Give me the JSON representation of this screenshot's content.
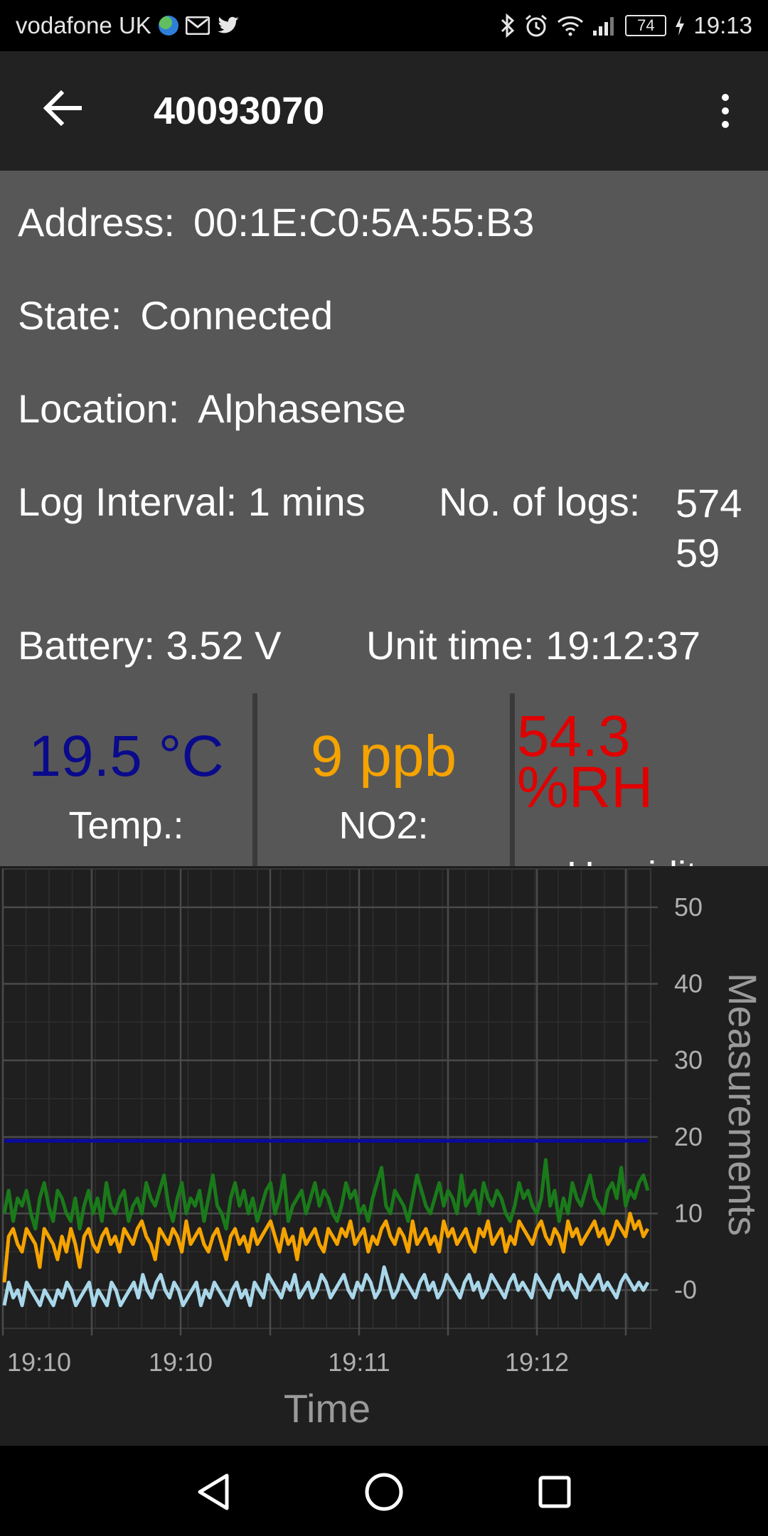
{
  "status_bar": {
    "carrier": "vodafone UK",
    "battery": "74",
    "time": "19:13",
    "left_icons": [
      "globe-icon",
      "gmail-icon",
      "twitter-icon"
    ],
    "right_icons": [
      "bluetooth-icon",
      "alarm-icon",
      "wifi-icon",
      "signal-icon",
      "battery-icon",
      "charging-icon"
    ]
  },
  "app_bar": {
    "title": "40093070",
    "back_icon": "arrow-left-icon",
    "menu_icon": "more-vert-icon"
  },
  "device_info": {
    "address_label": "Address:",
    "address_value": "00:1E:C0:5A:55:B3",
    "state_label": "State:",
    "state_value": "Connected",
    "location_label": "Location:",
    "location_value": "Alphasense",
    "log_interval_label": "Log Interval:",
    "log_interval_value": "1 mins",
    "logs_label": "No. of logs:",
    "logs_value_line1": "574",
    "logs_value_line2": "59",
    "battery_label": "Battery:",
    "battery_value": "3.52 V",
    "unit_time_label": "Unit time:",
    "unit_time_value": "19:12:37"
  },
  "tiles": [
    {
      "value": "19.5 °C",
      "label": "Temp.:",
      "color": "#0a0a8c"
    },
    {
      "value": "9 ppb",
      "label": "NO2:",
      "color": "#f5a300"
    },
    {
      "value_line1": "54.3",
      "value_line2": "%RH",
      "label_partial": "Humidity",
      "color": "#e00000"
    }
  ],
  "chart_data": {
    "type": "line",
    "xlabel": "Time",
    "ylabel": "Measurements",
    "x_ticks": [
      "19:10",
      "19:10",
      "19:11",
      "19:12"
    ],
    "y_ticks": [
      "50",
      "40",
      "30",
      "20",
      "10",
      "-0"
    ],
    "ylim": [
      -5,
      55
    ],
    "grid": true,
    "background": "#1f1f1f",
    "series": [
      {
        "color": "#0a0aa0",
        "values": [
          19.5,
          19.5,
          19.5,
          19.5,
          19.5,
          19.5,
          19.5,
          19.5,
          19.5,
          19.5,
          19.5,
          19.5,
          19.5,
          19.5,
          19.5,
          19.5,
          19.5,
          19.5,
          19.5,
          19.5,
          19.5,
          19.5,
          19.5,
          19.5,
          19.5,
          19.5,
          19.5,
          19.5,
          19.5,
          19.5,
          19.5,
          19.5,
          19.5,
          19.5,
          19.5,
          19.5,
          19.5,
          19.5,
          19.5,
          19.5,
          19.5,
          19.5,
          19.5,
          19.5,
          19.5,
          19.5,
          19.5,
          19.5,
          19.5,
          19.5,
          19.5,
          19.5,
          19.5,
          19.5,
          19.5,
          19.5,
          19.5,
          19.5,
          19.5,
          19.5,
          19.5,
          19.5,
          19.5,
          19.5,
          19.5,
          19.5,
          19.5,
          19.5,
          19.5,
          19.5,
          19.5,
          19.5,
          19.5,
          19.5,
          19.5,
          19.5,
          19.5,
          19.5,
          19.5,
          19.5,
          19.5,
          19.5,
          19.5,
          19.5,
          19.5,
          19.5,
          19.5,
          19.5,
          19.5,
          19.5,
          19.5,
          19.5,
          19.5,
          19.5,
          19.5,
          19.5,
          19.5,
          19.5,
          19.5,
          19.5,
          19.5,
          19.5,
          19.5,
          19.5,
          19.5,
          19.5,
          19.5,
          19.5,
          19.5,
          19.5,
          19.5,
          19.5,
          19.5,
          19.5,
          19.5,
          19.5,
          19.5,
          19.5,
          19.5,
          19.5,
          19.5,
          19.5,
          19.5,
          19.5,
          19.5,
          19.5,
          19.5,
          19.5,
          19.5,
          19.5,
          19.5,
          19.5,
          19.5,
          19.5,
          19.5,
          19.5,
          19.5,
          19.5,
          19.5,
          19.5,
          19.5,
          19.5,
          19.5,
          19.5,
          19.5,
          19.5,
          19.5,
          19.5
        ]
      },
      {
        "color": "#1a7a1a",
        "values": [
          10,
          13,
          9,
          12,
          11,
          13,
          10,
          8,
          12,
          14,
          11,
          9,
          13,
          12,
          10,
          9,
          12,
          8,
          11,
          13,
          10,
          12,
          9,
          14,
          11,
          10,
          12,
          13,
          9,
          11,
          12,
          10,
          14,
          12,
          11,
          13,
          15,
          11,
          9,
          12,
          14,
          10,
          12,
          11,
          13,
          9,
          12,
          15,
          11,
          10,
          8,
          12,
          14,
          11,
          13,
          10,
          12,
          9,
          11,
          13,
          14,
          10,
          12,
          15,
          9,
          11,
          12,
          13,
          10,
          12,
          14,
          11,
          13,
          12,
          10,
          9,
          11,
          14,
          12,
          13,
          10,
          11,
          9,
          12,
          14,
          16,
          11,
          10,
          13,
          12,
          11,
          9,
          12,
          15,
          13,
          11,
          10,
          12,
          14,
          11,
          13,
          12,
          10,
          15,
          11,
          12,
          13,
          10,
          14,
          12,
          11,
          13,
          12,
          10,
          9,
          11,
          14,
          12,
          13,
          11,
          10,
          12,
          17,
          11,
          13,
          9,
          12,
          10,
          14,
          12,
          11,
          13,
          15,
          12,
          11,
          10,
          13,
          14,
          12,
          16,
          11,
          13,
          12,
          14,
          15,
          13
        ]
      },
      {
        "color": "#f5a300",
        "values": [
          1,
          7,
          8,
          6,
          5,
          8,
          7,
          6,
          3,
          8,
          7,
          6,
          4,
          7,
          5,
          8,
          6,
          3,
          7,
          8,
          6,
          5,
          7,
          8,
          6,
          7,
          5,
          8,
          7,
          6,
          8,
          9,
          7,
          6,
          4,
          8,
          7,
          6,
          8,
          7,
          5,
          9,
          6,
          7,
          8,
          6,
          5,
          7,
          8,
          6,
          4,
          7,
          8,
          6,
          7,
          5,
          8,
          6,
          7,
          8,
          9,
          7,
          5,
          8,
          6,
          7,
          4,
          8,
          6,
          7,
          8,
          6,
          5,
          8,
          7,
          6,
          8,
          7,
          9,
          6,
          7,
          8,
          5,
          7,
          6,
          8,
          9,
          7,
          6,
          8,
          7,
          5,
          9,
          6,
          7,
          8,
          6,
          7,
          5,
          9,
          7,
          8,
          6,
          7,
          8,
          6,
          5,
          8,
          7,
          9,
          6,
          7,
          8,
          5,
          7,
          6,
          9,
          8,
          7,
          6,
          8,
          9,
          7,
          6,
          8,
          7,
          5,
          9,
          7,
          8,
          6,
          7,
          8,
          9,
          7,
          8,
          6,
          7,
          9,
          8,
          7,
          10,
          8,
          9,
          7,
          8
        ]
      },
      {
        "color": "#a9d7ea",
        "values": [
          -2,
          1,
          -1,
          0,
          -2,
          1,
          0,
          -1,
          -2,
          0,
          -1,
          -2,
          0,
          -1,
          1,
          0,
          -2,
          -1,
          0,
          1,
          -2,
          0,
          -1,
          -2,
          1,
          0,
          -2,
          -1,
          0,
          1,
          -1,
          2,
          0,
          -1,
          1,
          2,
          0,
          -1,
          1,
          0,
          -2,
          -1,
          0,
          1,
          -2,
          0,
          -1,
          1,
          0,
          -1,
          -2,
          0,
          1,
          -1,
          0,
          -2,
          1,
          0,
          -1,
          2,
          1,
          0,
          -1,
          1,
          0,
          2,
          -1,
          0,
          1,
          -1,
          0,
          2,
          1,
          -1,
          0,
          1,
          2,
          0,
          -1,
          1,
          0,
          2,
          1,
          -1,
          0,
          3,
          1,
          -1,
          0,
          2,
          1,
          0,
          -1,
          1,
          2,
          0,
          1,
          -1,
          0,
          2,
          1,
          0,
          -1,
          1,
          2,
          0,
          1,
          -1,
          0,
          2,
          1,
          0,
          -1,
          1,
          2,
          0,
          1,
          0,
          -1,
          2,
          1,
          0,
          -1,
          1,
          2,
          0,
          1,
          0,
          -1,
          2,
          1,
          0,
          1,
          2,
          0,
          1,
          0,
          -1,
          1,
          2,
          1,
          0,
          1,
          0,
          1
        ]
      }
    ]
  },
  "nav_bar": {
    "icons": [
      "nav-back-icon",
      "nav-home-icon",
      "nav-recents-icon"
    ]
  }
}
